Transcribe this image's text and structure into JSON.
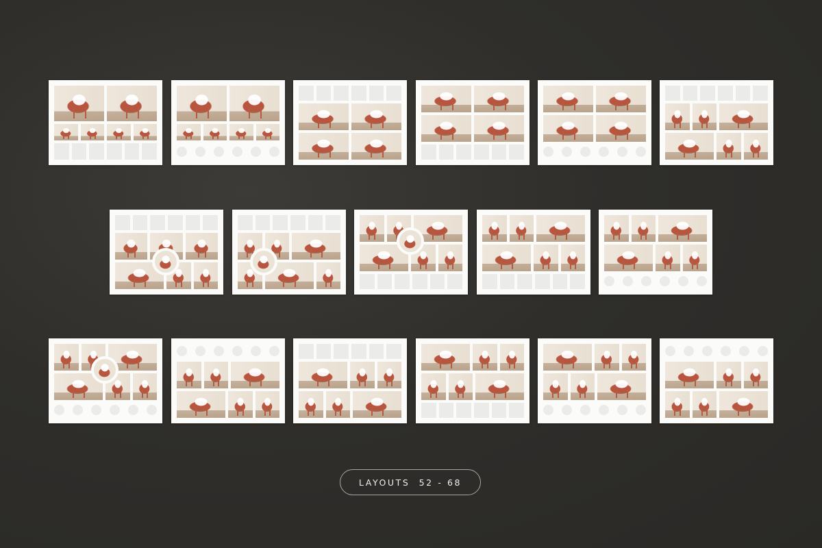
{
  "badge": {
    "label": "LAYOUTS  52 - 68"
  },
  "layouts": [
    {
      "name": "layout-52",
      "colors": {
        "card": "#fbfbfa",
        "placeholder": "#ebebea",
        "chair": "#b8553f"
      }
    },
    {
      "name": "layout-53"
    },
    {
      "name": "layout-54"
    },
    {
      "name": "layout-55"
    },
    {
      "name": "layout-56"
    },
    {
      "name": "layout-57"
    },
    {
      "name": "layout-58"
    },
    {
      "name": "layout-59"
    },
    {
      "name": "layout-60"
    },
    {
      "name": "layout-61"
    },
    {
      "name": "layout-62"
    },
    {
      "name": "layout-63"
    },
    {
      "name": "layout-64"
    },
    {
      "name": "layout-65"
    },
    {
      "name": "layout-66"
    },
    {
      "name": "layout-67"
    },
    {
      "name": "layout-68"
    }
  ]
}
